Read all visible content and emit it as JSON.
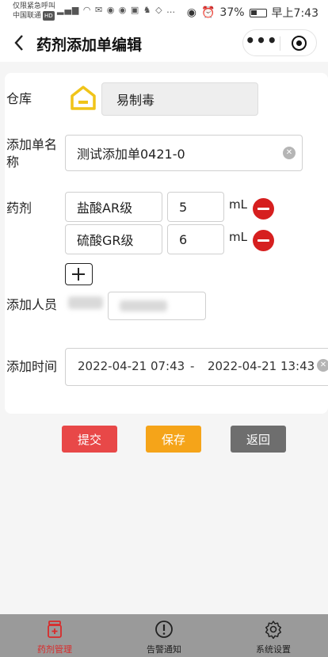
{
  "status_bar": {
    "carrier_line1": "仅限紧急呼叫",
    "carrier_line2": "中国联通",
    "carrier_badge": "HD",
    "battery": "37%",
    "time": "早上7:43"
  },
  "nav": {
    "back_icon": "chevron-left-icon",
    "title": "药剂添加单编辑"
  },
  "form": {
    "warehouse": {
      "label": "仓库",
      "value": "易制毒",
      "icon": "warehouse-icon",
      "icon_color": "#f0c419"
    },
    "name": {
      "label_line1": "添加单名",
      "label_line2": "称",
      "value": "测试添加单0421-0"
    },
    "reagents": {
      "label": "药剂",
      "items": [
        {
          "name": "盐酸AR级",
          "qty": "5",
          "unit": "mL"
        },
        {
          "name": "硫酸GR级",
          "qty": "6",
          "unit": "mL"
        }
      ]
    },
    "staff": {
      "label": "添加人员"
    },
    "time": {
      "label": "添加时间",
      "start": "2022-04-21 07:43",
      "separator": "-",
      "end": "2022-04-21 13:43"
    }
  },
  "actions": {
    "submit": "提交",
    "save": "保存",
    "back": "返回",
    "colors": {
      "submit": "#e84848",
      "save": "#f5a419",
      "back": "#6e6e6e"
    }
  },
  "tabbar": {
    "tabs": [
      {
        "label": "药剂管理",
        "icon": "medicine-icon",
        "active": true
      },
      {
        "label": "告警通知",
        "icon": "alert-circle-icon",
        "active": false
      },
      {
        "label": "系统设置",
        "icon": "gear-icon",
        "active": false
      }
    ],
    "active_color": "#d92b2b"
  }
}
